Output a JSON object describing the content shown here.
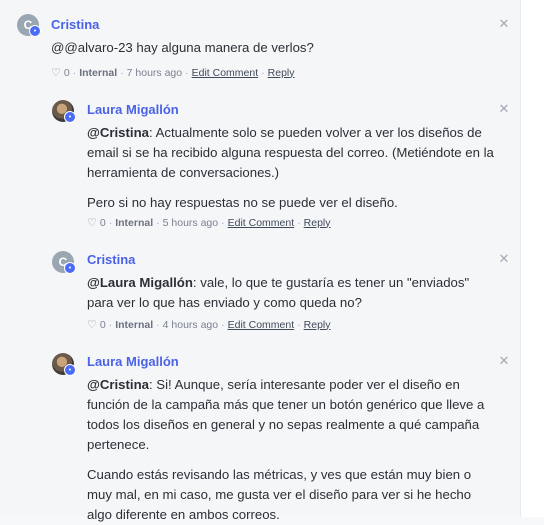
{
  "comments": [
    {
      "author": "Cristina",
      "avatar_letter": "C",
      "paragraphs": [
        {
          "mention": "",
          "text": "@@alvaro-23 hay alguna manera de verlos?"
        }
      ],
      "meta": {
        "likes": "0",
        "visibility": "Internal",
        "time": "7 hours ago",
        "edit": "Edit Comment",
        "reply": "Reply"
      }
    },
    {
      "author": "Laura Migallón",
      "paragraphs": [
        {
          "mention": "@Cristina",
          "text": ": Actualmente solo se pueden volver a ver los diseños de email si se ha recibido alguna respuesta del correo. (Metiéndote en la herramienta de conversaciones.)"
        },
        {
          "mention": "",
          "text": "Pero si no hay respuestas no se puede ver el diseño."
        }
      ],
      "meta": {
        "likes": "0",
        "visibility": "Internal",
        "time": "5 hours ago",
        "edit": "Edit Comment",
        "reply": "Reply"
      }
    },
    {
      "author": "Cristina",
      "avatar_letter": "C",
      "paragraphs": [
        {
          "mention": "@Laura Migallón",
          "text": ": vale, lo que te gustaría es tener un \"enviados\" para ver lo que has enviado y como queda no?"
        }
      ],
      "meta": {
        "likes": "0",
        "visibility": "Internal",
        "time": "4 hours ago",
        "edit": "Edit Comment",
        "reply": "Reply"
      }
    },
    {
      "author": "Laura Migallón",
      "paragraphs": [
        {
          "mention": "@Cristina",
          "text": ": Si! Aunque, sería interesante poder ver el diseño en función de la campaña más que tener un botón genérico que lleve a todos los diseños en general y no sepas realmente a qué campaña pertenece."
        },
        {
          "mention": "",
          "text": "Cuando estás revisando las métricas, y ves que están muy bien o muy mal, en mi caso, me gusta ver el diseño para ver si he hecho algo diferente en ambos correos."
        }
      ]
    }
  ],
  "icons": {
    "close": "close-icon",
    "like": "heart-icon",
    "badge": "user-badge-icon"
  },
  "colors": {
    "author": "#4a63e6",
    "badge": "#4a6cf7"
  }
}
